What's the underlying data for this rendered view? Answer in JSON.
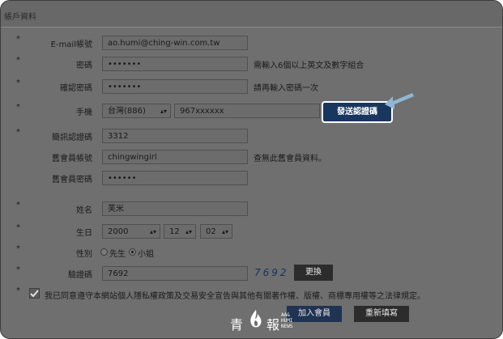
{
  "header": {
    "title": "帳戶資料"
  },
  "required_mark": "*",
  "fields": {
    "email": {
      "label": "E-mail帳號",
      "value": "ao.humi@ching-win.com.tw"
    },
    "password": {
      "label": "密碼",
      "value": "•••••••",
      "hint": "需輸入6個以上英文及數字組合"
    },
    "confirm_password": {
      "label": "確認密碼",
      "value": "•••••••",
      "hint": "請再輸入密碼一次"
    },
    "phone": {
      "label": "手機",
      "country": "台灣(886)",
      "number": "967xxxxxx",
      "sms_button": "發送認證碼"
    },
    "sms_code": {
      "label": "簡訊認證碼",
      "value": "3312"
    },
    "old_account": {
      "label": "舊會員帳號",
      "value": "chingwingirl",
      "hint": "查無此舊會員資料。"
    },
    "old_password": {
      "label": "舊會員密碼",
      "value": "••••••"
    },
    "name": {
      "label": "姓名",
      "value": "芙米"
    },
    "birthday": {
      "label": "生日",
      "year": "2000",
      "month": "12",
      "day": "02"
    },
    "gender": {
      "label": "性別",
      "male": "先生",
      "female": "小姐",
      "selected": "female"
    },
    "captcha": {
      "label": "驗證碼",
      "value": "7692",
      "image_text": "7692",
      "refresh_button": "更換"
    }
  },
  "agreement": {
    "text": "我已同意遵守本網站個人隱私權政策及交易安全宣告與其他有關著作權、版權、商標專用權等之法律規定。",
    "checked": true
  },
  "actions": {
    "submit": "加入會員",
    "reset": "重新填寫"
  },
  "watermark": {
    "char_left": "青",
    "char_right": "報",
    "small_lines": [
      "AA&",
      "HUMI",
      "NEWS"
    ]
  },
  "colors": {
    "overlay": "#6f6f6f",
    "accent_button": "#19365e",
    "arrow": "#8fb6d3",
    "captcha": "#16335c"
  }
}
